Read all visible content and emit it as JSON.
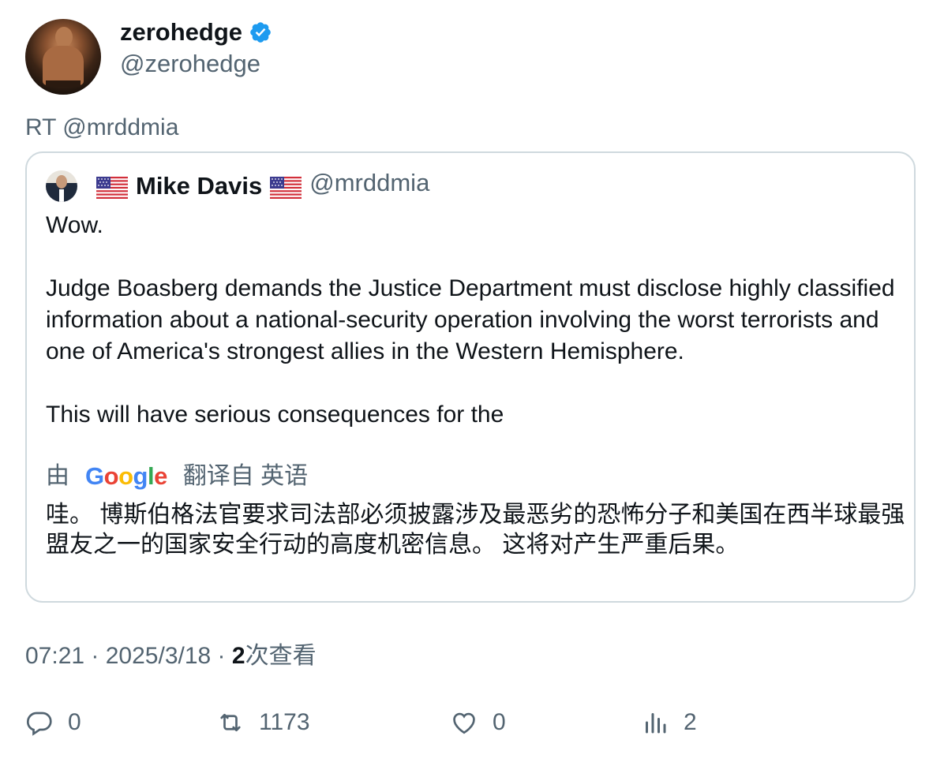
{
  "author": {
    "name": "zerohedge",
    "handle": "@zerohedge",
    "verified_color": "#1d9bf0"
  },
  "retweet_label": "RT @mrddmia",
  "quote": {
    "flag_left": "🇺🇸",
    "name": "Mike Davis",
    "flag_right": "🇺🇸",
    "handle": "@mrddmia",
    "text": {
      "line1": "Wow.",
      "para2": "Judge Boasberg demands the Justice Department must disclose highly classified information about a national-security operation involving the worst terrorists and one of America's strongest allies in the Western Hemisphere.",
      "para3": "This will have serious consequences for the"
    },
    "translation_prefix": "由",
    "translation_suffix": "翻译自 英语",
    "translation": "哇。 博斯伯格法官要求司法部必须披露涉及最恶劣的恐怖分子和美国在西半球最强盟友之一的国家安全行动的高度机密信息。 这将对产生严重后果。"
  },
  "meta": {
    "time": "07:21",
    "date": "2025/3/18",
    "views_count": "2",
    "views_label": "次查看"
  },
  "actions": {
    "replies": "0",
    "retweets": "1173",
    "likes": "0",
    "views": "2"
  },
  "icons": {
    "reply": "reply-icon",
    "retweet": "retweet-icon",
    "like": "heart-icon",
    "analytics": "analytics-icon"
  },
  "colors": {
    "secondary_text": "#536471",
    "primary_text": "#0f1419",
    "border": "#cfd9de",
    "verified": "#1d9bf0"
  }
}
